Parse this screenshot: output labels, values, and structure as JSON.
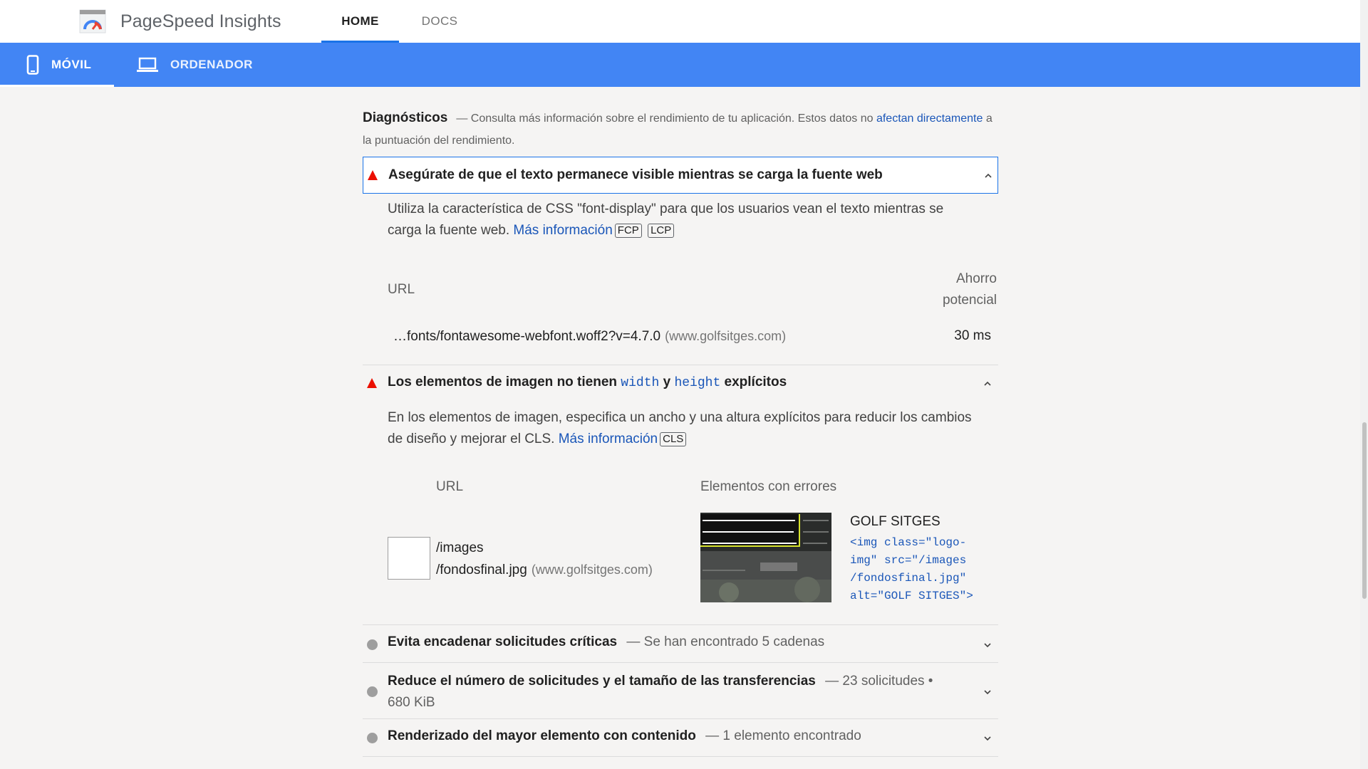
{
  "header": {
    "brand": "PageSpeed Insights",
    "tabs": [
      {
        "label": "HOME",
        "active": true
      },
      {
        "label": "DOCS",
        "active": false
      }
    ]
  },
  "device_tabs": [
    {
      "label": "MÓVIL",
      "icon": "phone-icon",
      "active": true
    },
    {
      "label": "ORDENADOR",
      "icon": "laptop-icon",
      "active": false
    }
  ],
  "diagnostics": {
    "title": "Diagnósticos",
    "intro_before": "— Consulta más información sobre el rendimiento de tu aplicación. Estos datos no ",
    "intro_link": "afectan directamente",
    "intro_after": " a la puntuación del rendimiento."
  },
  "audit_font": {
    "title": "Asegúrate de que el texto permanece visible mientras se carga la fuente web",
    "description": "Utiliza la característica de CSS \"font-display\" para que los usuarios vean el texto mientras se carga la fuente web.",
    "learn_more": "Más información",
    "tags": [
      "FCP",
      "LCP"
    ],
    "col_url": "URL",
    "col_savings_line1": "Ahorro",
    "col_savings_line2": "potencial",
    "row": {
      "url": "…fonts/fontawesome-webfont.woff2?v=4.7.0",
      "host": "(www.golfsitges.com)",
      "savings": "30 ms"
    }
  },
  "audit_images": {
    "title_before": "Los elementos de imagen no tienen ",
    "code_width": "width",
    "title_mid": " y ",
    "code_height": "height",
    "title_after": " explícitos",
    "description": "En los elementos de imagen, especifica un ancho y una altura explícitos para reducir los cambios de diseño y mejorar el CLS.",
    "learn_more": "Más información",
    "tags": [
      "CLS"
    ],
    "col_url": "URL",
    "col_elements": "Elementos con errores",
    "row": {
      "url_line1": "/images",
      "url_line2": "/fondosfinal.jpg",
      "host": "(www.golfsitges.com)",
      "element_label": "GOLF SITGES",
      "snippet_lines": [
        "<img class=\"logo-",
        "img\" src=\"/images",
        "/fondosfinal.jpg\"",
        "alt=\"GOLF SITGES\">"
      ]
    }
  },
  "audits_collapsed": [
    {
      "title": "Evita encadenar solicitudes críticas",
      "summary": "— Se han encontrado 5 cadenas"
    },
    {
      "title": "Reduce el número de solicitudes y el tamaño de las transferencias",
      "summary": "— 23 solicitudes •",
      "summary2": "680 KiB"
    },
    {
      "title": "Renderizado del mayor elemento con contenido",
      "summary": "— 1 elemento encontrado"
    }
  ],
  "colors": {
    "device_bar": "#4285f4",
    "fail": "#eb0f00",
    "link": "#1a56b8",
    "neutral_dot": "#9e9e9e"
  }
}
